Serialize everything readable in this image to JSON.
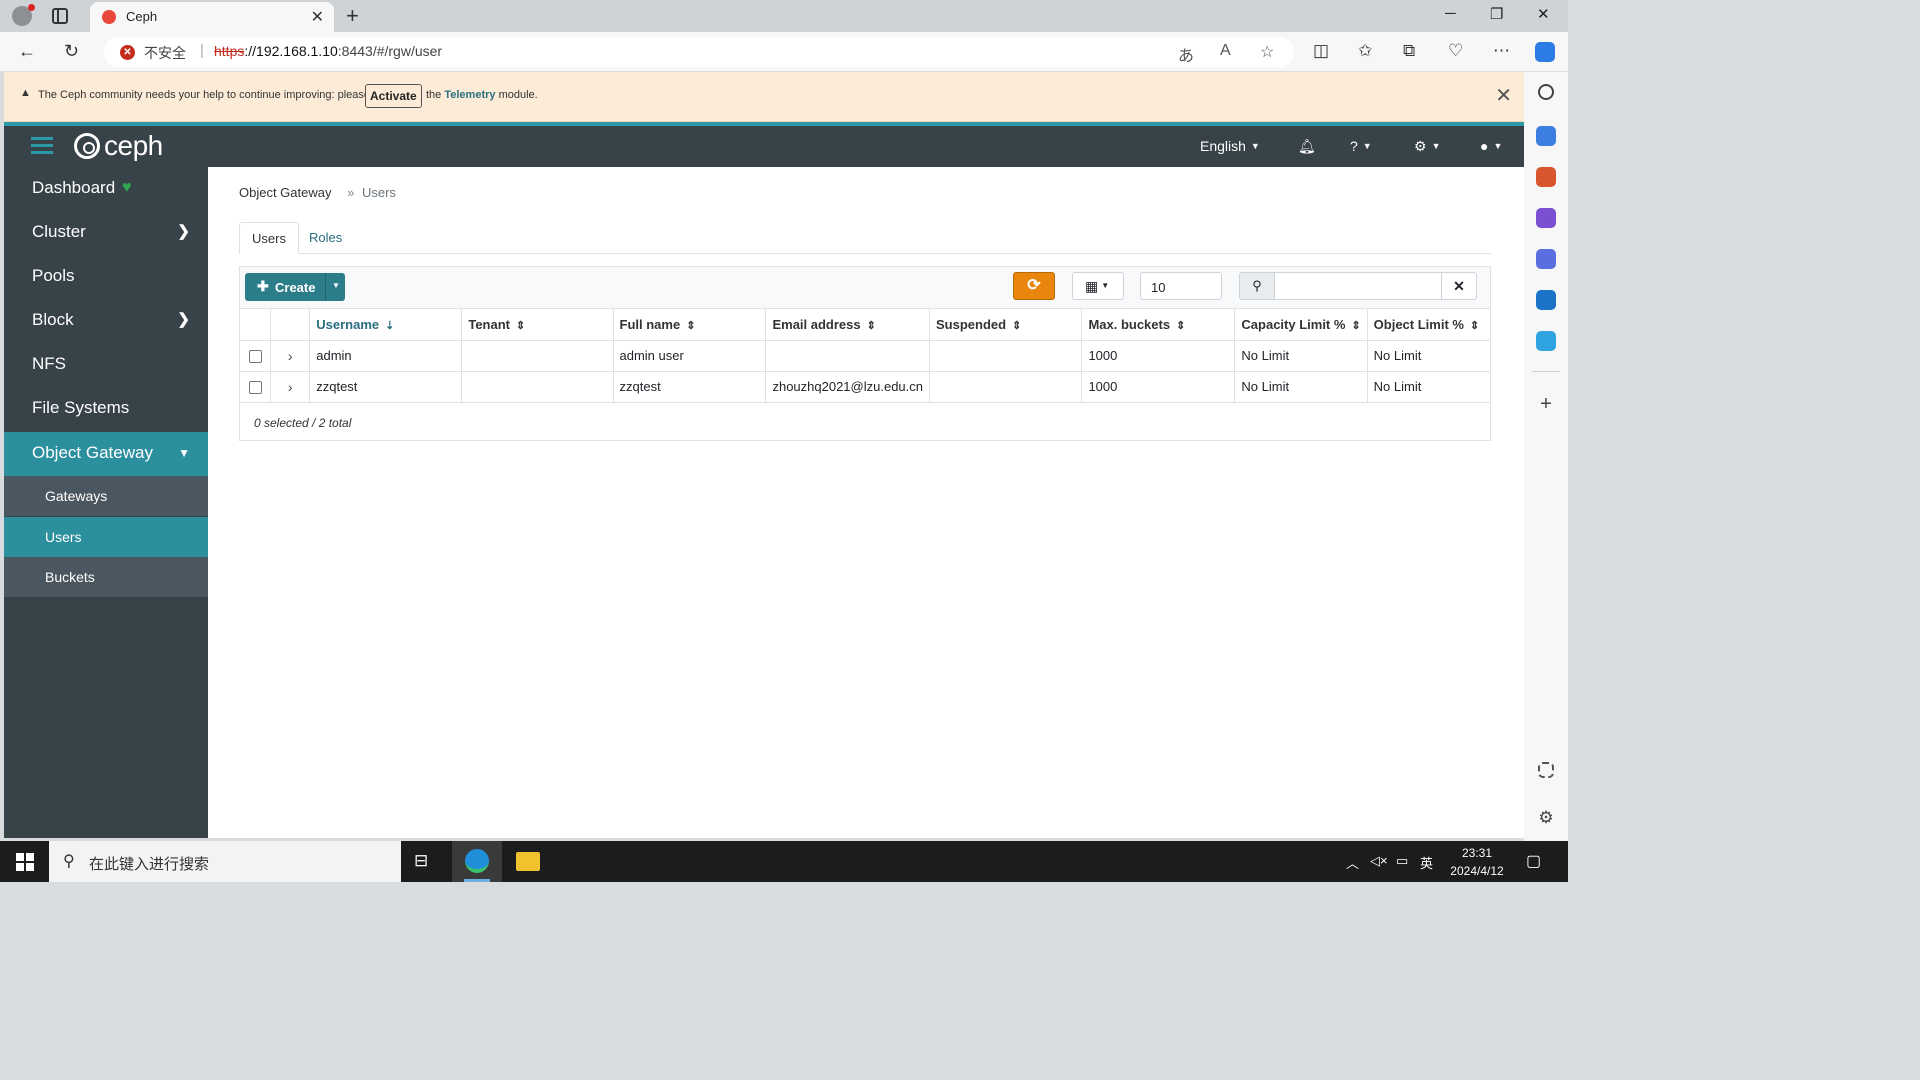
{
  "browser": {
    "tab_title": "Ceph",
    "address": {
      "security_label": "不安全",
      "url_scheme": "https",
      "url_host": "://192.168.1.10",
      "url_rest": ":8443/#/rgw/user"
    }
  },
  "notice": {
    "text_before": "The Ceph community needs your help to continue improving: please",
    "activate_label": "Activate",
    "text_the": "the",
    "telemetry_label": "Telemetry",
    "text_after": "module."
  },
  "topnav": {
    "logo_text": "ceph",
    "language": "English"
  },
  "sidebar": {
    "items": [
      {
        "label": "Dashboard"
      },
      {
        "label": "Cluster"
      },
      {
        "label": "Pools"
      },
      {
        "label": "Block"
      },
      {
        "label": "NFS"
      },
      {
        "label": "File Systems"
      },
      {
        "label": "Object Gateway"
      }
    ],
    "subitems": [
      {
        "label": "Gateways"
      },
      {
        "label": "Users"
      },
      {
        "label": "Buckets"
      }
    ]
  },
  "breadcrumb": {
    "parent": "Object Gateway",
    "current": "Users"
  },
  "tabs": [
    {
      "label": "Users"
    },
    {
      "label": "Roles"
    }
  ],
  "toolbar": {
    "create_label": "Create",
    "page_size": "10",
    "search_value": ""
  },
  "table": {
    "columns": [
      "Username",
      "Tenant",
      "Full name",
      "Email address",
      "Suspended",
      "Max. buckets",
      "Capacity Limit %",
      "Object Limit %"
    ],
    "rows": [
      [
        "admin",
        "",
        "admin user",
        "",
        "",
        "1000",
        "No Limit",
        "No Limit"
      ],
      [
        "zzqtest",
        "",
        "zzqtest",
        "zhouzhq2021@lzu.edu.cn",
        "",
        "1000",
        "No Limit",
        "No Limit"
      ]
    ],
    "footer": "0 selected / 2 total"
  },
  "taskbar": {
    "search_placeholder": "在此键入进行搜索",
    "ime": "英",
    "time": "23:31",
    "date": "2024/4/12"
  },
  "colors": {
    "accent": "#2b8f9e",
    "nav_bg": "#374249",
    "refresh": "#e9860d",
    "notice_bg": "#fcecd7"
  }
}
